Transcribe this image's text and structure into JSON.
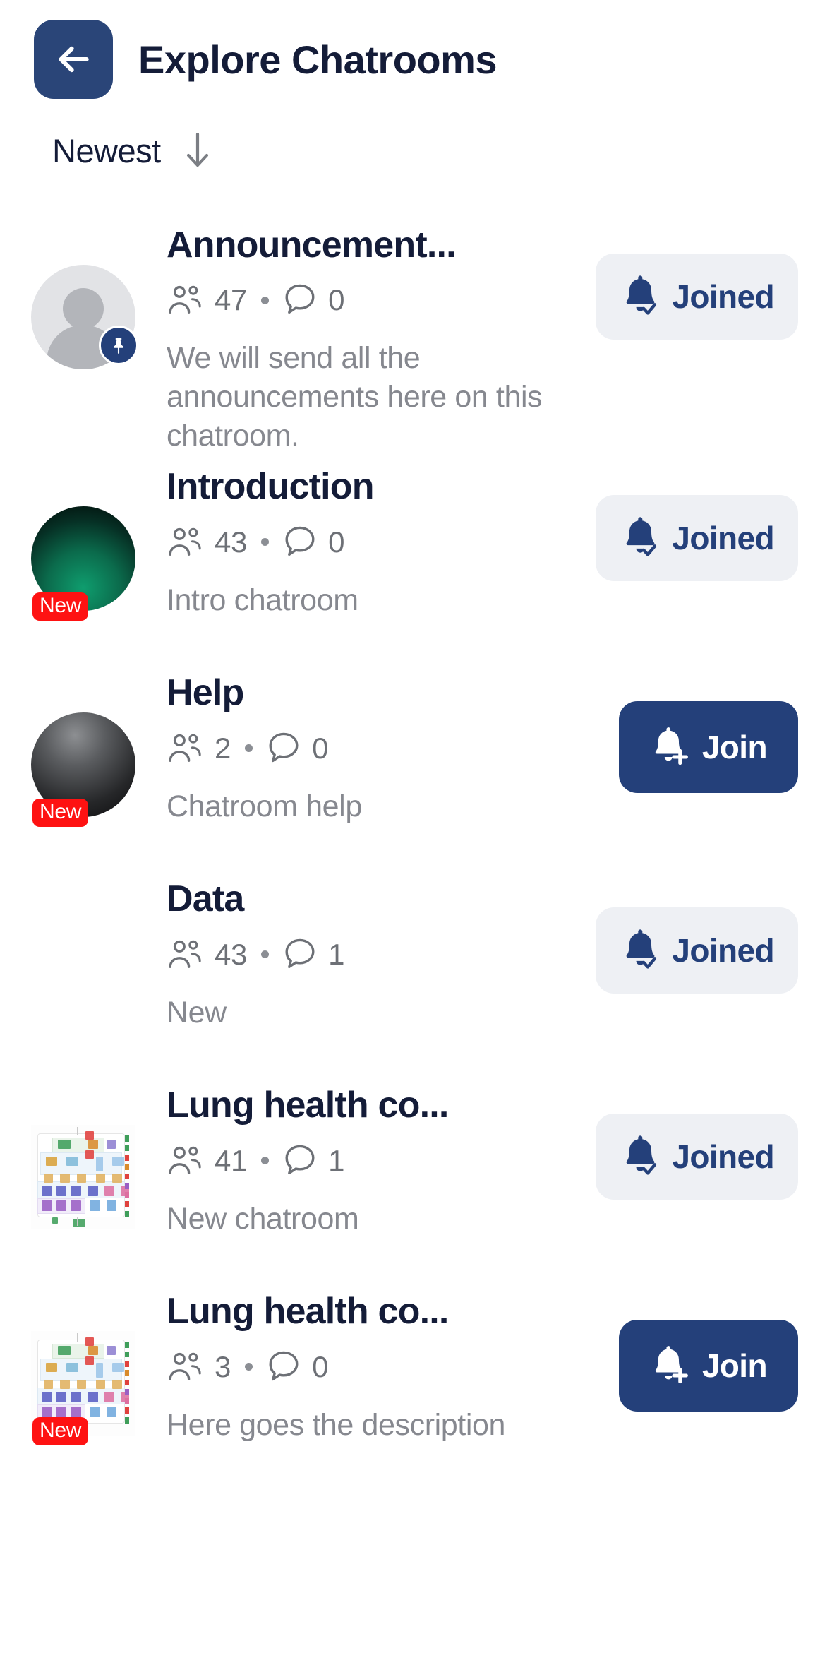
{
  "header": {
    "back_icon": "arrow-left-icon",
    "title": "Explore Chatrooms"
  },
  "sort": {
    "label": "Newest",
    "icon": "arrow-down-icon"
  },
  "icons": {
    "members": "people-icon",
    "comments": "comment-bubble-icon",
    "joined": "bell-check-icon",
    "join": "bell-plus-icon",
    "pin": "pin-icon"
  },
  "colors": {
    "primary": "#24407a",
    "title": "#141c38",
    "muted": "#86888f",
    "joined_bg": "#eef0f4",
    "new_badge": "#fe1212"
  },
  "labels": {
    "joined": "Joined",
    "join": "Join",
    "new": "New"
  },
  "rooms": [
    {
      "name": "Announcement...",
      "members": "47",
      "comments": "0",
      "description": "We will send all the announcements here on this chatroom.",
      "avatar": "placeholder",
      "pinned": true,
      "is_new": false,
      "button": "Joined",
      "button_state": "joined"
    },
    {
      "name": "Introduction",
      "members": "43",
      "comments": "0",
      "description": "Intro chatroom",
      "avatar": "grad-green",
      "pinned": false,
      "is_new": true,
      "button": "Joined",
      "button_state": "joined"
    },
    {
      "name": "Help",
      "members": "2",
      "comments": "0",
      "description": "Chatroom help",
      "avatar": "grad-dark",
      "pinned": false,
      "is_new": true,
      "button": "Join",
      "button_state": "join"
    },
    {
      "name": "Data",
      "members": "43",
      "comments": "1",
      "description": "New",
      "avatar": "none",
      "pinned": false,
      "is_new": false,
      "button": "Joined",
      "button_state": "joined"
    },
    {
      "name": "Lung health co...",
      "members": "41",
      "comments": "1",
      "description": "New chatroom",
      "avatar": "diagram",
      "pinned": false,
      "is_new": false,
      "button": "Joined",
      "button_state": "joined"
    },
    {
      "name": "Lung health co...",
      "members": "3",
      "comments": "0",
      "description": "Here goes the description",
      "avatar": "diagram",
      "pinned": false,
      "is_new": true,
      "button": "Join",
      "button_state": "join"
    }
  ]
}
